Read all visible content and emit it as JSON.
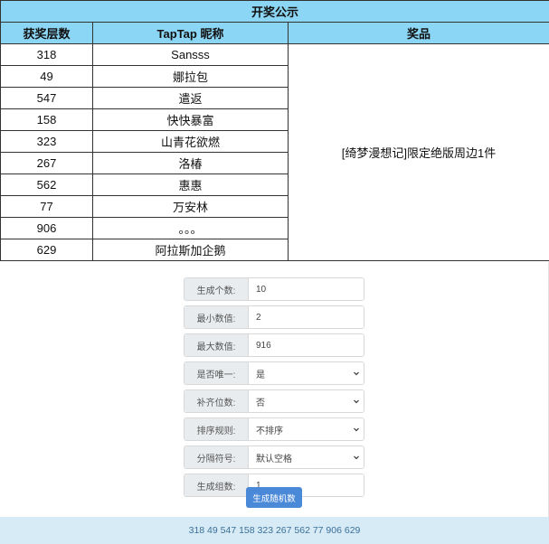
{
  "table": {
    "title": "开奖公示",
    "headers": [
      "获奖层数",
      "TapTap 昵称",
      "奖品"
    ],
    "prize": "[绮梦漫想记]限定绝版周边1件",
    "rows": [
      {
        "floor": "318",
        "nick": "Sansss"
      },
      {
        "floor": "49",
        "nick": "娜拉包"
      },
      {
        "floor": "547",
        "nick": "遣返"
      },
      {
        "floor": "158",
        "nick": "快快暴富"
      },
      {
        "floor": "323",
        "nick": "山青花欲燃"
      },
      {
        "floor": "267",
        "nick": "洛椿"
      },
      {
        "floor": "562",
        "nick": "惠惠"
      },
      {
        "floor": "77",
        "nick": "万安林"
      },
      {
        "floor": "906",
        "nick": "。。。"
      },
      {
        "floor": "629",
        "nick": "阿拉斯加企鹅"
      }
    ]
  },
  "form": {
    "fields": [
      {
        "label": "生成个数:",
        "value": "10",
        "type": "input"
      },
      {
        "label": "最小数值:",
        "value": "2",
        "type": "input"
      },
      {
        "label": "最大数值:",
        "value": "916",
        "type": "input"
      },
      {
        "label": "是否唯一:",
        "value": "是",
        "type": "select"
      },
      {
        "label": "补齐位数:",
        "value": "否",
        "type": "select"
      },
      {
        "label": "排序规则:",
        "value": "不排序",
        "type": "select"
      },
      {
        "label": "分隔符号:",
        "value": "默认空格",
        "type": "select"
      },
      {
        "label": "生成组数:",
        "value": "1",
        "type": "input"
      }
    ],
    "button_label": "生成随机数"
  },
  "result": "318 49 547 158 323 267 562 77 906 629"
}
